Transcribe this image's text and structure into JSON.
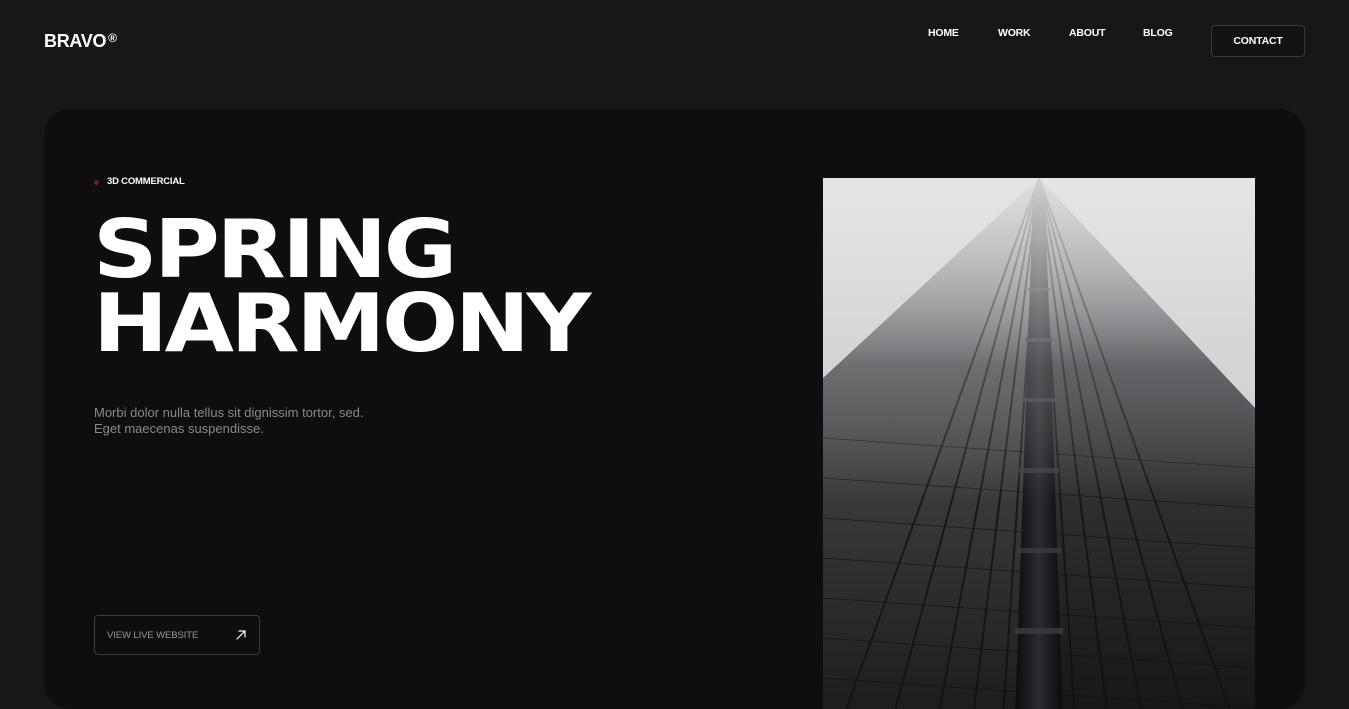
{
  "header": {
    "logo": "BRAVO",
    "logo_mark": "®",
    "nav": {
      "home": "HOME",
      "work": "WORK",
      "about": "ABOUT",
      "blog": "BLOG"
    },
    "contact": "CONTACT"
  },
  "hero": {
    "tag": "3D COMMERCIAL",
    "title_line1": "SPRING",
    "title_line2": "HARMONY",
    "description_line1": "Morbi dolor nulla tellus sit dignissim tortor, sed.",
    "description_line2": "Eget maecenas suspendisse.",
    "cta": "VIEW LIVE WEBSITE",
    "cta_icon": "arrow-up-right-icon",
    "image": "skyscraper-fog-photo"
  },
  "colors": {
    "page_bg": "#171717",
    "card_bg": "#0e0e0e",
    "accent_dot": "#6b1f1f",
    "text_primary": "#ffffff",
    "text_muted": "#8a8a8a"
  }
}
